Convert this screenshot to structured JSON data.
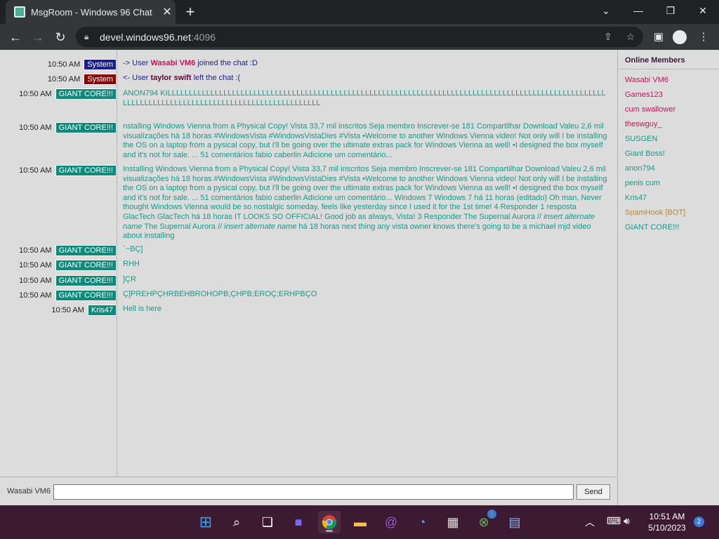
{
  "browser": {
    "tab_title": "MsgRoom - Windows 96 Chat",
    "url_host": "devel.windows96.net",
    "url_port": ":4096"
  },
  "chat": {
    "messages": [
      {
        "time": "10:50 AM",
        "user": "System",
        "badge": "system-blue",
        "kind": "join",
        "prefix": "-> User ",
        "name": "Wasabi VM6",
        "suffix": " joined the chat :D"
      },
      {
        "time": "10:50 AM",
        "user": "System",
        "badge": "system-red",
        "kind": "leave",
        "prefix": "<- User ",
        "name": "taylor swift",
        "suffix": " left the chat :("
      },
      {
        "time": "10:50 AM",
        "user": "GIANT CORE!!!",
        "badge": "giant",
        "text": "ANON794 KILLLLLLLLLLLLLLLLLLLLLLLLLLLLLLLLLLLLLLLLLLLLLLLLLLLLLLLLLLLLLLLLLLLLLLLLLLLLLLLLLLLLLLLLLLLLLLLLLLLLLLLLLLLLLLLLLLLLLLLLLLLLLLLLLLLLLLLLLLLLLLLLLLLL"
      },
      {
        "time": "10:50 AM",
        "user": "GIANT CORE!!!",
        "badge": "giant",
        "text": "nstalling Windows Vienna from a Physical Copy!  Vista 33,7 mil inscritos  Seja membro  Inscrever-se  181  Compartilhar  Download  Valeu 2,6 mil visualizações  há 18 horas  #WindowsVista #WindowsVistaDies #Vista •Welcome to another Windows Vienna video! Not only will I be installing the OS on a laptop from a pysical copy, but I'll be going over the ultimate extras pack for Windows Vienna as well!  •I designed the box myself and it's not for sale. ... 51 comentários fabio caberlin Adicione um comentário..."
      },
      {
        "time": "10:50 AM",
        "user": "GIANT CORE!!!",
        "badge": "giant",
        "text": "Installing Windows Vienna from a Physical Copy!  Vista 33,7 mil inscritos  Seja membro  Inscrever-se  181  Compartilhar  Download  Valeu 2,6 mil visualizações  há 18 horas  #WindowsVista #WindowsVistaDies #Vista •Welcome to another Windows Vienna video! Not only will I be installing the OS on a laptop from a pysical copy, but I'll be going over the ultimate extras pack for Windows Vienna as well!  •I designed the box myself and it's not for sale. ... 51 comentários fabio caberlin Adicione um comentário... Windows 7  Windows 7 há 11 horas (editado) Oh man, Never thought Windows Vienna would be so nostalgic someday, feels like yesterday since I used it for the 1st time!  4  Responder 1 resposta GlacTech GlacTech há 18 horas IT LOOKS SO OFFICIAL! Good job as always, Vista!  3  Responder  The Supernal Aurora // ",
        "ital1": "insert alternate name",
        "text2": " The Supernal Aurora // ",
        "ital2": "insert alternate name",
        "text3": " há 18 horas next thing any vista owner knows there's going to be a michael mjd video about installing"
      },
      {
        "time": "10:50 AM",
        "user": "GIANT CORE!!!",
        "badge": "giant",
        "text": "´~BÇ]"
      },
      {
        "time": "10:50 AM",
        "user": "GIANT CORE!!!",
        "badge": "giant",
        "text": "RHH"
      },
      {
        "time": "10:50 AM",
        "user": "GIANT CORE!!!",
        "badge": "giant",
        "text": "]ÇR"
      },
      {
        "time": "10:50 AM",
        "user": "GIANT CORE!!!",
        "badge": "giant",
        "text": "Ç]PREHPÇHRBEHBROHOPB;ÇHPB;EROÇ;ERHPBÇO"
      },
      {
        "time": "10:50 AM",
        "user": "Kris47",
        "badge": "kris",
        "text": "Hell is here"
      }
    ],
    "nickname": "Wasabi VM6",
    "send_label": "Send"
  },
  "members": {
    "title": "Online Members",
    "list": [
      {
        "name": "Wasabi VM6",
        "color": "#c0185a"
      },
      {
        "name": "Games123",
        "color": "#c0185a"
      },
      {
        "name": "cum swallower",
        "color": "#c0185a"
      },
      {
        "name": "theswguy_",
        "color": "#c0185a"
      },
      {
        "name": "SUSGEN",
        "color": "#159a8a"
      },
      {
        "name": "Giant Boss!",
        "color": "#159a8a"
      },
      {
        "name": "anon794",
        "color": "#159a8a"
      },
      {
        "name": "penis cum",
        "color": "#159a8a"
      },
      {
        "name": "Kris47",
        "color": "#159a8a"
      },
      {
        "name": "SpamHook [BOT]",
        "color": "#b58a3a"
      },
      {
        "name": "GIANT CORE!!!",
        "color": "#159a8a"
      }
    ]
  },
  "taskbar": {
    "clock_time": "10:51 AM",
    "clock_date": "5/10/2023",
    "notification_count": "2",
    "xbox_badge": "1"
  }
}
